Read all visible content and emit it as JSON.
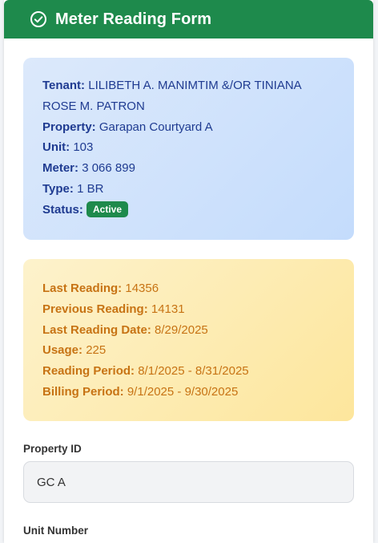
{
  "header": {
    "title": "Meter Reading Form"
  },
  "tenant_info": {
    "tenant_label": "Tenant:",
    "tenant_value": "LILIBETH A. MANIMTIM &/OR TINIANA ROSE M. PATRON",
    "property_label": "Property:",
    "property_value": "Garapan Courtyard A",
    "unit_label": "Unit:",
    "unit_value": "103",
    "meter_label": "Meter:",
    "meter_value": "3 066 899",
    "type_label": "Type:",
    "type_value": "1 BR",
    "status_label": "Status:",
    "status_value": "Active"
  },
  "reading_info": {
    "last_reading_label": "Last Reading:",
    "last_reading_value": "14356",
    "previous_reading_label": "Previous Reading:",
    "previous_reading_value": "14131",
    "last_reading_date_label": "Last Reading Date:",
    "last_reading_date_value": "8/29/2025",
    "usage_label": "Usage:",
    "usage_value": "225",
    "reading_period_label": "Reading Period:",
    "reading_period_value": "8/1/2025 - 8/31/2025",
    "billing_period_label": "Billing Period:",
    "billing_period_value": "9/1/2025 - 9/30/2025"
  },
  "form": {
    "property_id_label": "Property ID",
    "property_id_value": "GC A",
    "unit_number_label": "Unit Number"
  },
  "colors": {
    "header_bg": "#1e8a4c",
    "status_badge": "#1e8a4c",
    "tenant_text": "#1f3b91",
    "reading_text": "#c77314"
  },
  "icons": {
    "header_icon": "check-circle-icon"
  }
}
